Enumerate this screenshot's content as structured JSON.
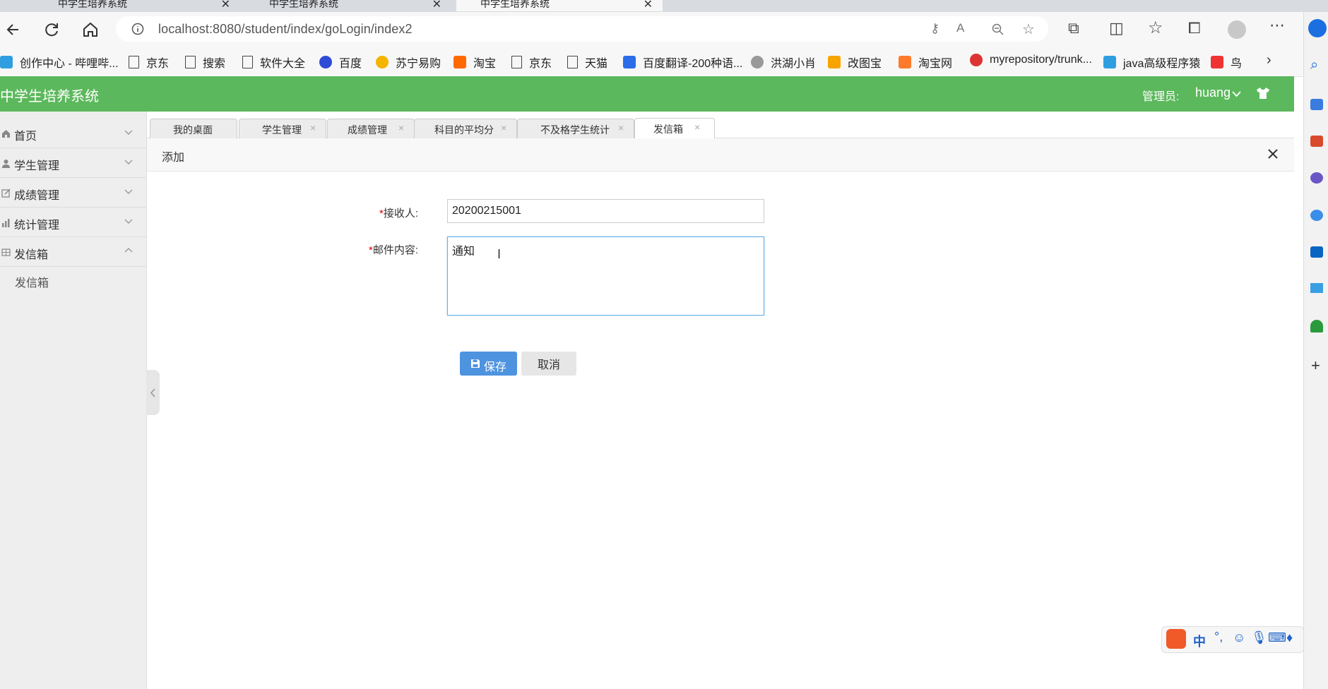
{
  "browser": {
    "tabs": [
      {
        "label": "中学生培养系统",
        "active": false
      },
      {
        "label": "中学生培养系统",
        "active": false
      },
      {
        "label": "中学生培养系统",
        "active": true
      }
    ],
    "address": "localhost:8080/student/index/goLogin/index2",
    "bookmarks": [
      "创作中心 - 哔哩哔...",
      "京东",
      "搜索",
      "软件大全",
      "百度",
      "苏宁易购",
      "淘宝",
      "京东",
      "天猫",
      "百度翻译-200种语...",
      "洪湖小肖",
      "改图宝",
      "淘宝网",
      "myrepository/trunk...",
      "java高级程序猿",
      "鸟"
    ]
  },
  "app": {
    "title": "中学生培养系统",
    "admin_label": "管理员:",
    "admin_user": "huang"
  },
  "sidebar": {
    "items": [
      {
        "label": "首页",
        "icon": "home-icon"
      },
      {
        "label": "学生管理",
        "icon": "user-icon"
      },
      {
        "label": "成绩管理",
        "icon": "edit-icon"
      },
      {
        "label": "统计管理",
        "icon": "bar-chart-icon"
      },
      {
        "label": "发信箱",
        "icon": "grid-icon"
      }
    ],
    "subitems": [
      "发信箱"
    ]
  },
  "pagetabs": [
    {
      "label": "我的桌面"
    },
    {
      "label": "学生管理"
    },
    {
      "label": "成绩管理"
    },
    {
      "label": "科目的平均分"
    },
    {
      "label": "不及格学生统计"
    },
    {
      "label": "发信箱"
    }
  ],
  "panel": {
    "title": "添加"
  },
  "form": {
    "recipient_label": "接收人:",
    "recipient_value": "20200215001",
    "content_label": "邮件内容:",
    "content_value": "通知",
    "required_mark": "*",
    "save_label": "保存",
    "cancel_label": "取消"
  },
  "ime": {
    "mode": "中"
  },
  "colors": {
    "header": "#5cb85c",
    "primary_button": "#4e93df"
  }
}
